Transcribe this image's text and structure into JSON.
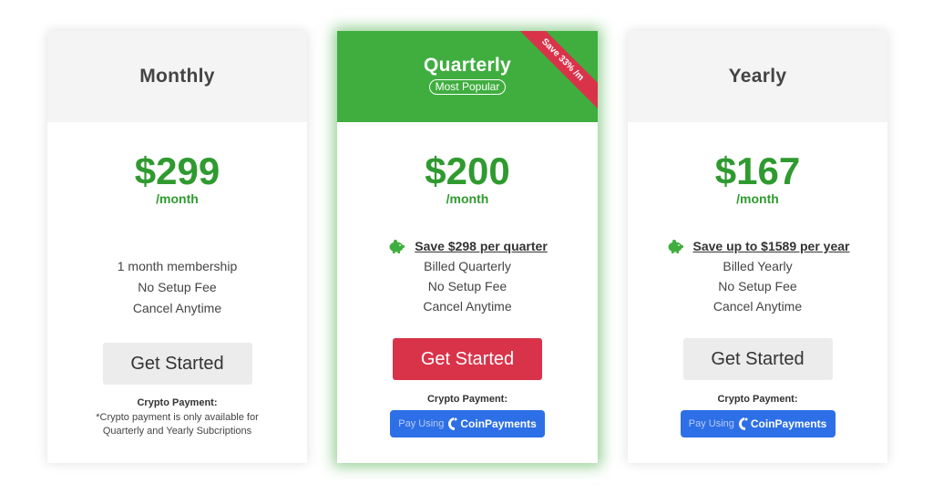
{
  "plans": [
    {
      "name": "Monthly",
      "price": "$299",
      "period": "/month",
      "features": [
        "1 month membership",
        "No Setup Fee",
        "Cancel Anytime"
      ],
      "cta": "Get Started",
      "crypto_label": "Crypto Payment:",
      "crypto_note_1": "*Crypto payment is only available for",
      "crypto_note_2": "Quarterly and Yearly Subcriptions"
    },
    {
      "name": "Quarterly",
      "badge": "Most Popular",
      "ribbon": "Save 33% /m",
      "price": "$200",
      "period": "/month",
      "savings": "Save $298 per quarter",
      "features": [
        "Billed Quarterly",
        "No Setup Fee",
        "Cancel Anytime"
      ],
      "cta": "Get Started",
      "crypto_label": "Crypto Payment:",
      "pay_using": "Pay Using",
      "coinpayments": "CoinPayments"
    },
    {
      "name": "Yearly",
      "price": "$167",
      "period": "/month",
      "savings": "Save up to $1589 per year",
      "features": [
        "Billed Yearly",
        "No Setup Fee",
        "Cancel Anytime"
      ],
      "cta": "Get Started",
      "crypto_label": "Crypto Payment:",
      "pay_using": "Pay Using",
      "coinpayments": "CoinPayments"
    }
  ],
  "colors": {
    "price_green": "#2f9a2f",
    "header_green": "#3fae3f",
    "cta_red": "#d9334a",
    "coin_blue": "#2d6fe6"
  }
}
